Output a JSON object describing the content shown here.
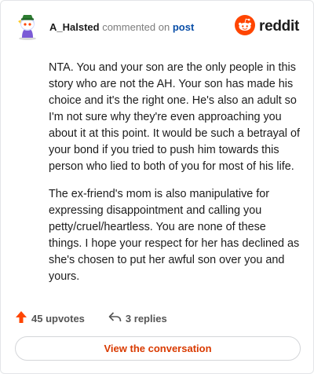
{
  "comment": {
    "username": "A_Halsted",
    "action_text": "commented on",
    "post_link_text": "post",
    "brand": "reddit",
    "paragraphs": [
      "NTA. You and your son are the only people in this story who are not the AH. Your son has made his choice and it's the right one. He's also an adult so I'm not sure why they're even approaching you about it at this point. It would be such a betrayal of your bond if you tried to push him towards this person who lied to both of you for most of his life.",
      "The ex-friend's mom is also manipulative for expressing disappointment and calling you petty/cruel/heartless. You are none of these things. I hope your respect for her has declined as she's chosen to put her awful son over you and yours."
    ],
    "upvotes_text": "45 upvotes",
    "replies_text": "3 replies",
    "cta_label": "View the conversation"
  },
  "colors": {
    "reddit_orange": "#ff4500",
    "link_blue": "#0a4fa8",
    "cta_text": "#d93a00"
  },
  "icons": {
    "avatar": "snoo-avatar",
    "logo": "reddit-snoo-icon",
    "upvote": "upvote-arrow-icon",
    "reply": "reply-arrow-icon"
  }
}
